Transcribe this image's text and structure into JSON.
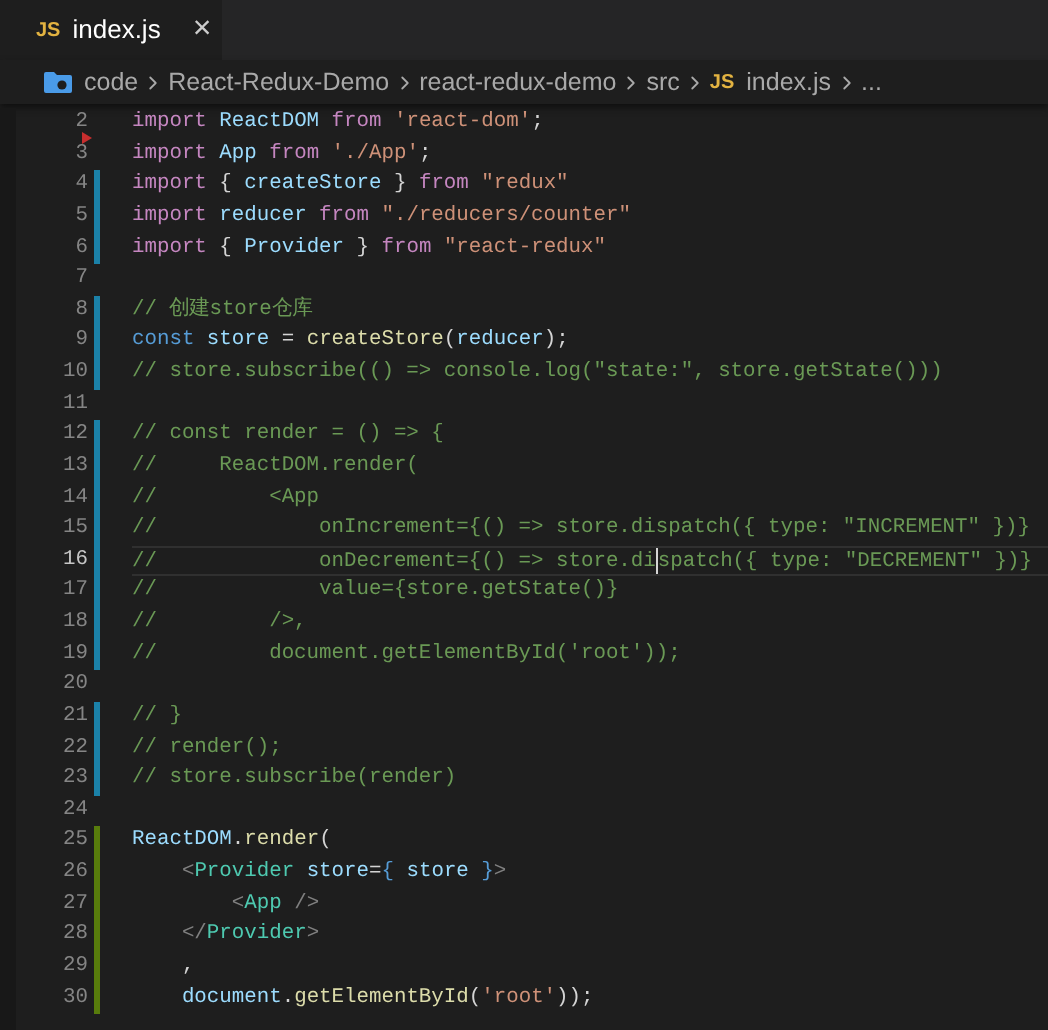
{
  "tab": {
    "icon": "JS",
    "label": "index.js",
    "close": "×"
  },
  "breadcrumb": [
    {
      "kind": "folder",
      "text": "code"
    },
    {
      "kind": "plain",
      "text": "React-Redux-Demo"
    },
    {
      "kind": "plain",
      "text": "react-redux-demo"
    },
    {
      "kind": "plain",
      "text": "src"
    },
    {
      "kind": "file",
      "icon": "JS",
      "text": "index.js"
    },
    {
      "kind": "plain",
      "text": "..."
    }
  ],
  "lines": [
    {
      "number": "2",
      "selected": false,
      "tokens": [
        {
          "kind": "keyword",
          "text": "import "
        },
        {
          "kind": "identifier",
          "text": "ReactDOM "
        },
        {
          "kind": "keyword",
          "text": "from "
        },
        {
          "kind": "string",
          "text": "'react-dom'"
        },
        {
          "kind": "punctuation",
          "text": ";"
        }
      ]
    },
    {
      "number": "3",
      "selected": false,
      "breakpoint": true,
      "tokens": [
        {
          "kind": "keyword",
          "text": "import "
        },
        {
          "kind": "identifier",
          "text": "App "
        },
        {
          "kind": "keyword",
          "text": "from "
        },
        {
          "kind": "string",
          "text": "'./App'"
        },
        {
          "kind": "punctuation",
          "text": ";"
        }
      ]
    },
    {
      "number": "4",
      "modified": true,
      "selected": false,
      "tokens": [
        {
          "kind": "keyword",
          "text": "import "
        },
        {
          "kind": "punctuation",
          "text": "{ "
        },
        {
          "kind": "identifier",
          "text": "createStore "
        },
        {
          "kind": "punctuation",
          "text": "} "
        },
        {
          "kind": "keyword",
          "text": "from "
        },
        {
          "kind": "string",
          "text": "\"redux\""
        }
      ]
    },
    {
      "number": "5",
      "modified": true,
      "selected": false,
      "tokens": [
        {
          "kind": "keyword",
          "text": "import "
        },
        {
          "kind": "identifier",
          "text": "reducer "
        },
        {
          "kind": "keyword",
          "text": "from "
        },
        {
          "kind": "string",
          "text": "\"./reducers/counter\""
        }
      ]
    },
    {
      "number": "6",
      "modified": true,
      "selected": false,
      "tokens": [
        {
          "kind": "keyword",
          "text": "import "
        },
        {
          "kind": "punctuation",
          "text": "{ "
        },
        {
          "kind": "identifier",
          "text": "Provider "
        },
        {
          "kind": "punctuation",
          "text": "} "
        },
        {
          "kind": "keyword",
          "text": "from "
        },
        {
          "kind": "string",
          "text": "\"react-redux\""
        }
      ]
    },
    {
      "number": "7",
      "selected": false
    },
    {
      "number": "8",
      "modified": true,
      "selected": false,
      "tokens": [
        {
          "kind": "comment",
          "text": "// 创建store仓库"
        }
      ]
    },
    {
      "number": "9",
      "modified": true,
      "selected": false,
      "tokens": [
        {
          "kind": "declaration",
          "text": "const "
        },
        {
          "kind": "identifier",
          "text": "store "
        },
        {
          "kind": "punctuation",
          "text": "= "
        },
        {
          "kind": "function",
          "text": "createStore"
        },
        {
          "kind": "punctuation",
          "text": "("
        },
        {
          "kind": "identifier",
          "text": "reducer"
        },
        {
          "kind": "punctuation",
          "text": ");"
        }
      ]
    },
    {
      "number": "10",
      "modified": true,
      "selected": false,
      "tokens": [
        {
          "kind": "comment",
          "text": "// store.subscribe(() => console.log(\"state:\", store.getState()))"
        }
      ]
    },
    {
      "number": "11",
      "selected": false
    },
    {
      "number": "12",
      "modified": true,
      "selected": false,
      "tokens": [
        {
          "kind": "comment",
          "text": "// const render = () => {"
        }
      ]
    },
    {
      "number": "13",
      "modified": true,
      "selected": false,
      "tokens": [
        {
          "kind": "comment",
          "text": "//     ReactDOM.render("
        }
      ]
    },
    {
      "number": "14",
      "modified": true,
      "selected": false,
      "tokens": [
        {
          "kind": "comment",
          "text": "//         <App"
        }
      ]
    },
    {
      "number": "15",
      "modified": true,
      "selected": false,
      "tokens": [
        {
          "kind": "comment",
          "text": "//             onIncrement={() => store.dispatch({ type: \"INCREMENT\" })}"
        }
      ]
    },
    {
      "number": "16",
      "modified": true,
      "selected": true,
      "tokens": [
        {
          "kind": "comment",
          "text": "//             onDecrement={() => store.di"
        },
        {
          "kind": "caret"
        },
        {
          "kind": "comment",
          "text": "spatch({ type: \"DECREMENT\" })}"
        }
      ]
    },
    {
      "number": "17",
      "modified": true,
      "selected": false,
      "tokens": [
        {
          "kind": "comment",
          "text": "//             value={store.getState()}"
        }
      ]
    },
    {
      "number": "18",
      "modified": true,
      "selected": false,
      "tokens": [
        {
          "kind": "comment",
          "text": "//         />,"
        }
      ]
    },
    {
      "number": "19",
      "modified": true,
      "selected": false,
      "tokens": [
        {
          "kind": "comment",
          "text": "//         document.getElementById('root'));"
        }
      ]
    },
    {
      "number": "20",
      "selected": false
    },
    {
      "number": "21",
      "modified": true,
      "selected": false,
      "tokens": [
        {
          "kind": "comment",
          "text": "// }"
        }
      ]
    },
    {
      "number": "22",
      "modified": true,
      "selected": false,
      "tokens": [
        {
          "kind": "comment",
          "text": "// render();"
        }
      ]
    },
    {
      "number": "23",
      "modified": true,
      "selected": false,
      "tokens": [
        {
          "kind": "comment",
          "text": "// store.subscribe(render)"
        }
      ]
    },
    {
      "number": "24",
      "selected": false
    },
    {
      "number": "25",
      "added": true,
      "selected": false,
      "tokens": [
        {
          "kind": "identifier",
          "text": "ReactDOM"
        },
        {
          "kind": "punctuation",
          "text": "."
        },
        {
          "kind": "function",
          "text": "render"
        },
        {
          "kind": "punctuation",
          "text": "("
        }
      ]
    },
    {
      "number": "26",
      "added": true,
      "selected": false,
      "tokens": [
        {
          "kind": "tag",
          "text": "    <"
        },
        {
          "kind": "component",
          "text": "Provider "
        },
        {
          "kind": "identifier",
          "text": "store"
        },
        {
          "kind": "punctuation",
          "text": "="
        },
        {
          "kind": "declaration",
          "text": "{ "
        },
        {
          "kind": "identifier",
          "text": "store "
        },
        {
          "kind": "declaration",
          "text": "}"
        },
        {
          "kind": "tag",
          "text": ">"
        }
      ]
    },
    {
      "number": "27",
      "added": true,
      "selected": false,
      "tokens": [
        {
          "kind": "tag",
          "text": "        <"
        },
        {
          "kind": "component",
          "text": "App "
        },
        {
          "kind": "tag",
          "text": "/>"
        }
      ]
    },
    {
      "number": "28",
      "added": true,
      "selected": false,
      "tokens": [
        {
          "kind": "tag",
          "text": "    </"
        },
        {
          "kind": "component",
          "text": "Provider"
        },
        {
          "kind": "tag",
          "text": ">"
        }
      ]
    },
    {
      "number": "29",
      "added": true,
      "selected": false,
      "tokens": [
        {
          "kind": "punctuation",
          "text": "    ,"
        }
      ]
    },
    {
      "number": "30",
      "added": true,
      "selected": false,
      "tokens": [
        {
          "kind": "identifier",
          "text": "    document"
        },
        {
          "kind": "punctuation",
          "text": "."
        },
        {
          "kind": "function",
          "text": "getElementById"
        },
        {
          "kind": "punctuation",
          "text": "("
        },
        {
          "kind": "string",
          "text": "'root'"
        },
        {
          "kind": "punctuation",
          "text": "));"
        }
      ]
    }
  ]
}
